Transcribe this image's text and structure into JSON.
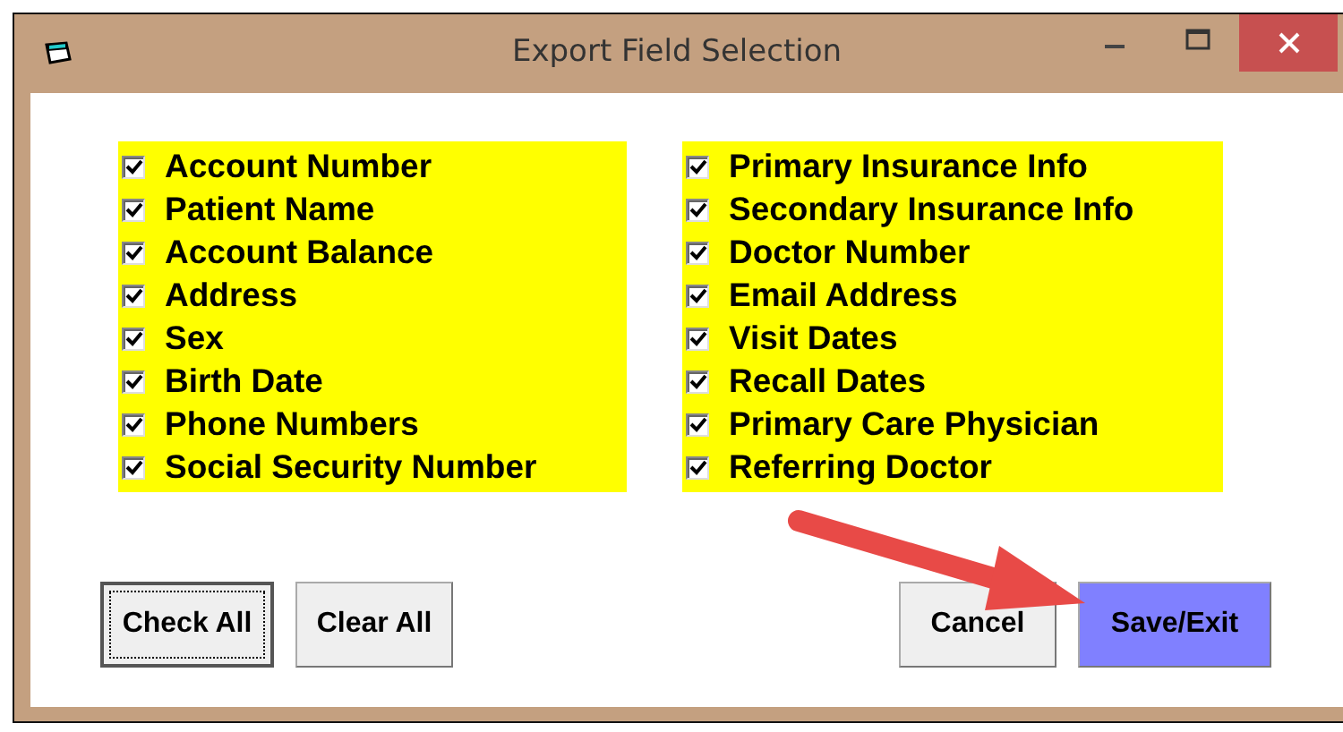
{
  "window": {
    "title": "Export Field Selection"
  },
  "field_columns": [
    [
      {
        "label": "Account Number",
        "checked": true
      },
      {
        "label": "Patient Name",
        "checked": true
      },
      {
        "label": "Account Balance",
        "checked": true
      },
      {
        "label": "Address",
        "checked": true
      },
      {
        "label": "Sex",
        "checked": true
      },
      {
        "label": "Birth Date",
        "checked": true
      },
      {
        "label": "Phone Numbers",
        "checked": true
      },
      {
        "label": "Social Security Number",
        "checked": true
      }
    ],
    [
      {
        "label": "Primary Insurance Info",
        "checked": true
      },
      {
        "label": "Secondary Insurance Info",
        "checked": true
      },
      {
        "label": "Doctor Number",
        "checked": true
      },
      {
        "label": "Email Address",
        "checked": true
      },
      {
        "label": "Visit Dates",
        "checked": true
      },
      {
        "label": "Recall Dates",
        "checked": true
      },
      {
        "label": "Primary Care Physician",
        "checked": true
      },
      {
        "label": "Referring Doctor",
        "checked": true
      }
    ]
  ],
  "buttons_left": [
    {
      "label": "Check All",
      "focused": true,
      "highlighted": false
    },
    {
      "label": "Clear All",
      "focused": false,
      "highlighted": false
    }
  ],
  "buttons_right": [
    {
      "label": "Cancel",
      "focused": false,
      "highlighted": false
    },
    {
      "label": "Save/Exit",
      "focused": false,
      "highlighted": true
    }
  ]
}
